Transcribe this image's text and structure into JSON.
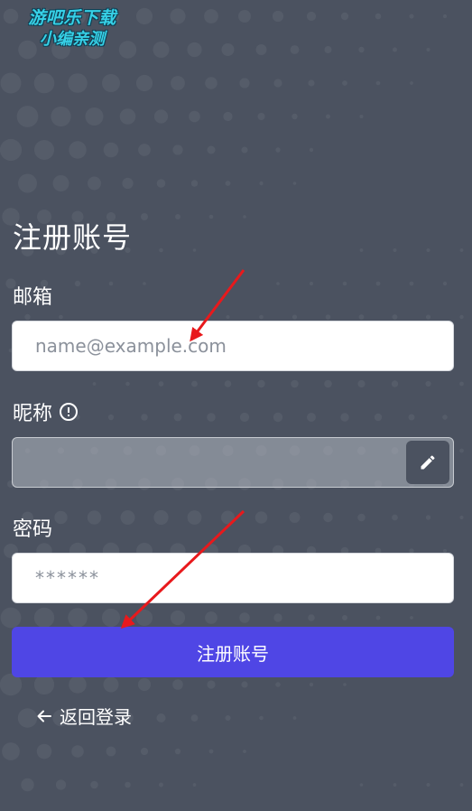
{
  "watermark": {
    "line1": "游吧乐下载",
    "line2": "小编亲测"
  },
  "form": {
    "title": "注册账号",
    "email": {
      "label": "邮箱",
      "placeholder": "name@example.com",
      "value": ""
    },
    "nickname": {
      "label": "昵称",
      "info_icon": "info-circle-icon",
      "value": "",
      "edit_icon": "pencil-icon"
    },
    "password": {
      "label": "密码",
      "placeholder": "******",
      "value": ""
    },
    "submit_label": "注册账号",
    "back_label": "返回登录",
    "back_icon": "arrow-left-icon"
  },
  "colors": {
    "background": "#4b5260",
    "primary_button": "#4f46e5",
    "annotation_arrow": "#e8191c",
    "watermark": "#36d0e6"
  }
}
